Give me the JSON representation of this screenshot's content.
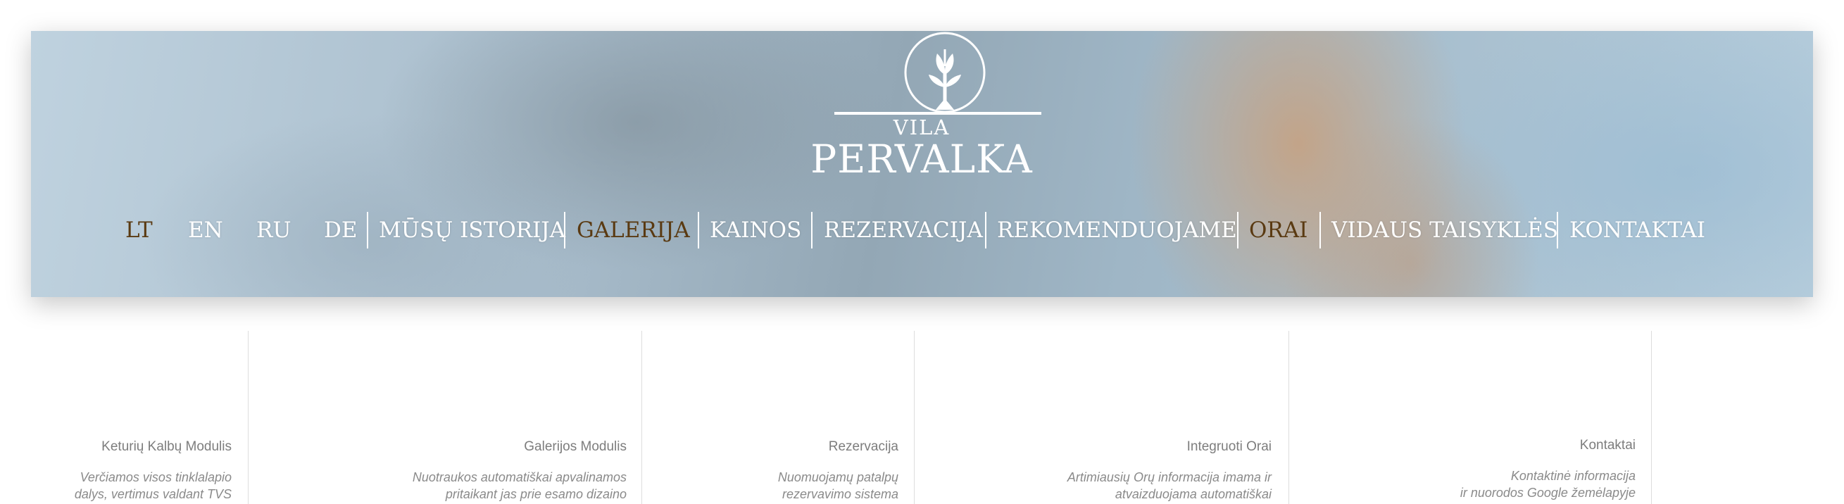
{
  "logo": {
    "small_text": "VILA",
    "big_text": "PERVALKA",
    "icon": "tree-sprout-emblem-icon"
  },
  "colors": {
    "active_nav": "#5a3a12",
    "nav_text": "#ffffff",
    "feature_title": "#7d7d7d",
    "feature_desc": "#8a8a8a"
  },
  "nav": {
    "languages": [
      {
        "label": "LT",
        "active": true
      },
      {
        "label": "EN",
        "active": false
      },
      {
        "label": "RU",
        "active": false
      },
      {
        "label": "DE",
        "active": false
      }
    ],
    "items": [
      {
        "label": "MŪSŲ ISTORIJA",
        "active": false
      },
      {
        "label": "GALERIJA",
        "active": true
      },
      {
        "label": "KAINOS",
        "active": false
      },
      {
        "label": "REZERVACIJA",
        "active": false
      },
      {
        "label": "REKOMENDUOJAME",
        "active": false
      },
      {
        "label": "ORAI",
        "active": true
      },
      {
        "label": "VIDAUS TAISYKLĖS",
        "active": false
      },
      {
        "label": "KONTAKTAI",
        "active": false
      }
    ]
  },
  "features": [
    {
      "title": "Keturių Kalbų Modulis",
      "desc_lines": [
        "Verčiamos visos tinklalapio",
        "dalys, vertimus valdant  TVS"
      ]
    },
    {
      "title": "Galerijos Modulis",
      "desc_lines": [
        "Nuotraukos automatiškai apvalinamos",
        "pritaikant jas prie esamo dizaino"
      ]
    },
    {
      "title": "Rezervacija",
      "desc_lines": [
        "Nuomuojamų patalpų",
        "rezervavimo sistema"
      ]
    },
    {
      "title": "Integruoti Orai",
      "desc_lines": [
        "Artimiausių Orų informacija imama ir",
        "atvaizduojama automatiškai"
      ]
    },
    {
      "title": "Kontaktai",
      "desc_lines": [
        "Kontaktinė informacija",
        "ir nuorodos Google  žemėlapyje"
      ]
    }
  ]
}
